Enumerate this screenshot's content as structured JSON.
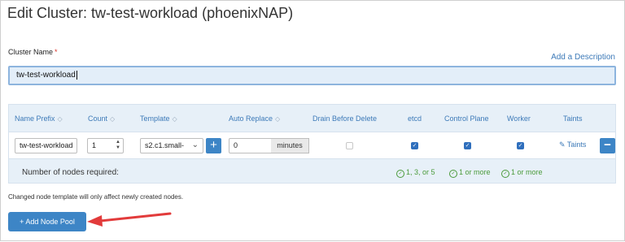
{
  "page": {
    "title": "Edit Cluster: tw-test-workload (phoenixNAP)"
  },
  "cluster_name": {
    "label": "Cluster Name",
    "required_marker": "*",
    "value": "tw-test-workload",
    "add_description": "Add a Description"
  },
  "node_pool": {
    "columns": {
      "name_prefix": "Name Prefix",
      "count": "Count",
      "template": "Template",
      "auto_replace": "Auto Replace",
      "drain": "Drain Before Delete",
      "etcd": "etcd",
      "control_plane": "Control Plane",
      "worker": "Worker",
      "taints": "Taints"
    },
    "row": {
      "name_prefix": "tw-test-workload",
      "count": "1",
      "template": "s2.c1.small-",
      "auto_replace": "0",
      "auto_replace_unit": "minutes",
      "drain_checked": false,
      "etcd_checked": true,
      "control_plane_checked": true,
      "worker_checked": true,
      "taints_link": "Taints"
    },
    "requirements": {
      "label": "Number of nodes required:",
      "etcd": "1, 3, or 5",
      "control_plane": "1 or more",
      "worker": "1 or more"
    }
  },
  "footer": {
    "note": "Changed node template will only affect newly created nodes.",
    "add_pool_button": "+ Add Node Pool"
  },
  "colors": {
    "accent": "#3d85c6",
    "link": "#3d7ab8",
    "success": "#4a9a3a",
    "annotation_arrow": "#e23b3b"
  },
  "icons": [
    "sort-icon",
    "spinner-icon",
    "chevron-down-icon",
    "plus-icon",
    "minus-icon",
    "pencil-icon",
    "check-circle-icon",
    "checkbox-icon"
  ]
}
